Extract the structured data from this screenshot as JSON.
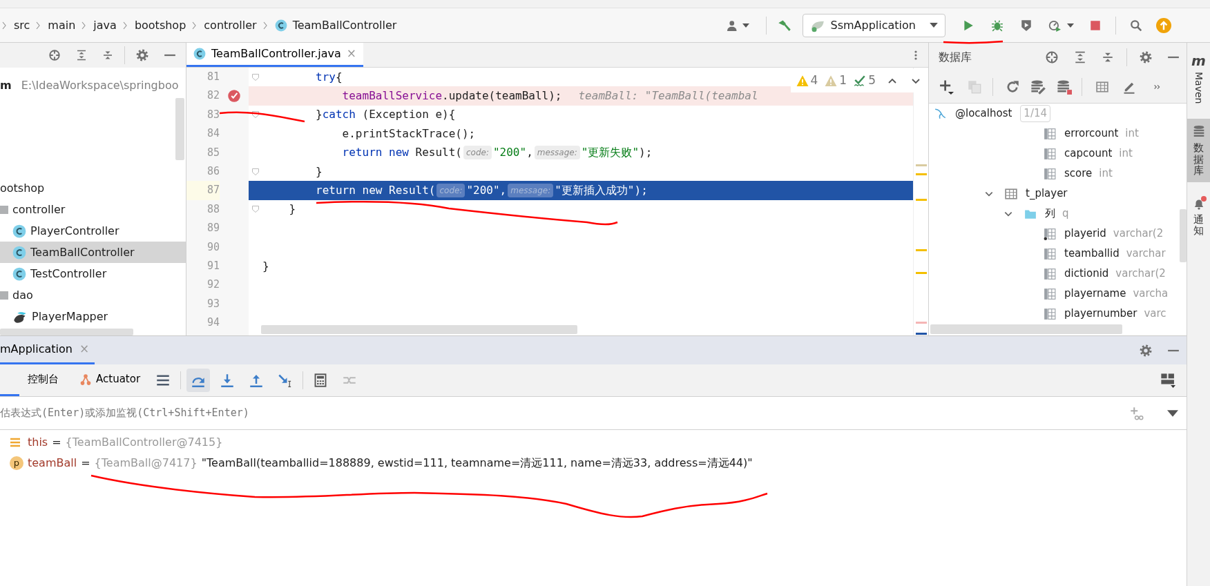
{
  "toolbar": {
    "breadcrumb": [
      {
        "label": "src",
        "kind": "dir"
      },
      {
        "label": "main",
        "kind": "dir"
      },
      {
        "label": "java",
        "kind": "dir"
      },
      {
        "label": "bootshop",
        "kind": "dir"
      },
      {
        "label": "controller",
        "kind": "dir"
      },
      {
        "label": "TeamBallController",
        "kind": "class"
      }
    ],
    "run_config": "SsmApplication"
  },
  "project": {
    "root": {
      "label": "m",
      "path": "E:\\IdeaWorkspace\\springboo"
    },
    "tree": [
      {
        "label": "ootshop",
        "selected": false,
        "children": [
          {
            "label": "controller",
            "kind": "package",
            "selected": false,
            "children": [
              {
                "label": "PlayerController",
                "kind": "class",
                "selected": false
              },
              {
                "label": "TeamBallController",
                "kind": "class",
                "selected": true
              },
              {
                "label": "TestController",
                "kind": "class",
                "selected": false
              }
            ]
          },
          {
            "label": "dao",
            "kind": "package",
            "selected": false,
            "children": [
              {
                "label": "PlayerMapper",
                "kind": "mapper",
                "selected": false
              }
            ]
          }
        ]
      }
    ]
  },
  "editor": {
    "tabs": [
      {
        "label": "TeamBallController.java",
        "close": "×",
        "selected": true
      }
    ],
    "inspections": [
      {
        "kind": "warning",
        "count": "4"
      },
      {
        "kind": "weak_warning",
        "count": "1"
      },
      {
        "kind": "typo",
        "count": "5"
      }
    ],
    "lines": [
      {
        "number": "81",
        "breakpoint": false,
        "current": false,
        "fold": true,
        "tokens": [
          {
            "kind": "keyword",
            "text": "        try"
          },
          {
            "kind": "plain",
            "text": "{"
          }
        ]
      },
      {
        "number": "82",
        "breakpoint": true,
        "current": false,
        "fold": false,
        "tokens": [
          {
            "kind": "field",
            "text": "            teamBallService"
          },
          {
            "kind": "plain",
            "text": ".update(teamBall);"
          },
          {
            "kind": "debug_value",
            "text": "teamBall: \"TeamBall(teambal"
          }
        ]
      },
      {
        "number": "83",
        "breakpoint": false,
        "current": false,
        "fold": true,
        "tokens": [
          {
            "kind": "plain",
            "text": "        }"
          },
          {
            "kind": "keyword",
            "text": "catch"
          },
          {
            "kind": "plain",
            "text": " (Exception e){"
          }
        ]
      },
      {
        "number": "84",
        "breakpoint": false,
        "current": false,
        "fold": false,
        "tokens": [
          {
            "kind": "plain",
            "text": "            e.printStackTrace();"
          }
        ]
      },
      {
        "number": "85",
        "breakpoint": false,
        "current": false,
        "fold": false,
        "tokens": [
          {
            "kind": "keyword",
            "text": "            return new"
          },
          {
            "kind": "plain",
            "text": " Result("
          },
          {
            "kind": "hint",
            "text": "code:"
          },
          {
            "kind": "string",
            "text": "\"200\""
          },
          {
            "kind": "plain",
            "text": ","
          },
          {
            "kind": "hint",
            "text": "message:"
          },
          {
            "kind": "string",
            "text": "\"更新失败\""
          },
          {
            "kind": "plain",
            "text": ");"
          }
        ]
      },
      {
        "number": "86",
        "breakpoint": false,
        "current": false,
        "fold": true,
        "tokens": [
          {
            "kind": "plain",
            "text": "        }"
          }
        ]
      },
      {
        "number": "87",
        "breakpoint": false,
        "current": true,
        "fold": false,
        "tokens": [
          {
            "kind": "keyword",
            "text": "        return new"
          },
          {
            "kind": "plain",
            "text": " Result("
          },
          {
            "kind": "hint",
            "text": "code:"
          },
          {
            "kind": "string",
            "text": "\"200\""
          },
          {
            "kind": "plain",
            "text": ","
          },
          {
            "kind": "hint",
            "text": "message:"
          },
          {
            "kind": "string",
            "text": "\"更新插入成功\""
          },
          {
            "kind": "plain",
            "text": ");"
          }
        ]
      },
      {
        "number": "88",
        "breakpoint": false,
        "current": false,
        "fold": true,
        "tokens": [
          {
            "kind": "plain",
            "text": "    }"
          }
        ]
      },
      {
        "number": "89",
        "breakpoint": false,
        "current": false,
        "fold": false
      },
      {
        "number": "90",
        "breakpoint": false,
        "current": false,
        "fold": false
      },
      {
        "number": "91",
        "breakpoint": false,
        "current": false,
        "fold": false,
        "tokens": [
          {
            "kind": "plain",
            "text": "}"
          }
        ]
      },
      {
        "number": "92",
        "breakpoint": false,
        "current": false,
        "fold": false
      },
      {
        "number": "93",
        "breakpoint": false,
        "current": false,
        "fold": false
      },
      {
        "number": "94",
        "breakpoint": false,
        "current": false,
        "fold": false
      }
    ]
  },
  "database": {
    "title": "数据库",
    "connection": {
      "label": "@localhost",
      "badge": "1/14"
    },
    "columns_above": [
      {
        "label": "errorcount",
        "type": "int",
        "key": false
      },
      {
        "label": "capcount",
        "type": "int",
        "key": false
      },
      {
        "label": "score",
        "type": "int",
        "key": false
      }
    ],
    "tree": [
      {
        "kind": "table",
        "label": "t_player",
        "expanded": true,
        "children": [
          {
            "kind": "folder",
            "label": "列",
            "hint": "q",
            "expanded": true,
            "children": [
              {
                "kind": "column",
                "label": "playerid",
                "type": "varchar(2",
                "key": true
              },
              {
                "kind": "column",
                "label": "teamballid",
                "type": "varchar",
                "key": false
              },
              {
                "kind": "column",
                "label": "dictionid",
                "type": "varchar(2",
                "key": false
              },
              {
                "kind": "column",
                "label": "playername",
                "type": "varcha",
                "key": false
              },
              {
                "kind": "column",
                "label": "playernumber",
                "type": "varc",
                "key": false
              }
            ]
          }
        ]
      }
    ]
  },
  "side_strip": [
    {
      "kind": "maven",
      "glyph": "m",
      "label": "Maven",
      "selected": false,
      "unread": false
    },
    {
      "kind": "database",
      "label": "数据库",
      "selected": true,
      "unread": false
    },
    {
      "kind": "notifications",
      "label": "通知",
      "selected": false,
      "unread": true
    }
  ],
  "debug": {
    "session_tab": {
      "label": "mApplication",
      "close": "×",
      "selected": true
    },
    "tabs": [
      {
        "kind": "cut",
        "selected": true
      },
      {
        "kind": "console",
        "label": "控制台",
        "selected": false
      },
      {
        "kind": "actuator",
        "label": "Actuator",
        "selected": false
      }
    ],
    "actions": [
      {
        "kind": "threads",
        "selected": false,
        "disabled": false
      },
      {
        "kind": "step_over",
        "selected": true,
        "disabled": false
      },
      {
        "kind": "step_into",
        "selected": false,
        "disabled": false
      },
      {
        "kind": "step_out",
        "selected": false,
        "disabled": false
      },
      {
        "kind": "run_to_cursor",
        "selected": false,
        "disabled": false
      },
      {
        "kind": "evaluate",
        "selected": false,
        "disabled": false
      },
      {
        "kind": "trace",
        "selected": false,
        "disabled": true
      }
    ],
    "evaluate_field": {
      "placeholder": "估表达式(Enter)或添加监视(Ctrl+Shift+Enter)"
    },
    "variables": [
      {
        "kind": "this",
        "name": "this",
        "op": "=",
        "ref": "{TeamBallController@7415}"
      },
      {
        "kind": "param",
        "badge": "p",
        "name": "teamBall",
        "op": "=",
        "ref": "{TeamBall@7417}",
        "string": "\"TeamBall(teamballid=188889, ewstid=111, teamname=清远111, name=清远33, address=清远44)\""
      }
    ]
  }
}
